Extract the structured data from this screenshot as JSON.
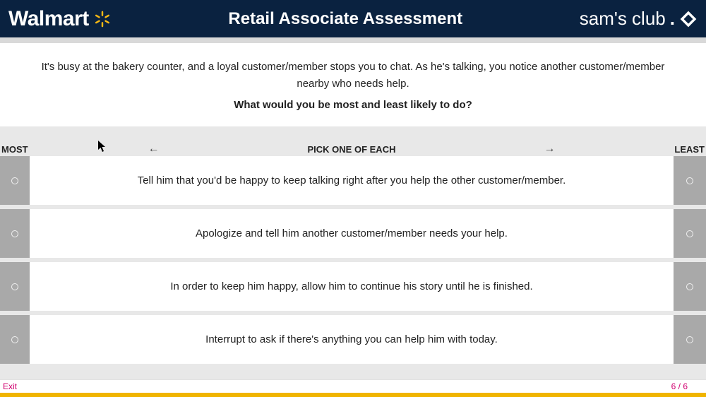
{
  "header": {
    "left_brand": "Walmart",
    "title": "Retail Associate Assessment",
    "right_brand": "sam's club"
  },
  "scenario": {
    "text": "It's busy at the bakery counter, and a loyal customer/member stops you to chat. As he's talking, you notice another customer/member nearby who needs help.",
    "question": "What would you be most and least likely to do?"
  },
  "columns": {
    "most": "MOST",
    "center": "PICK ONE OF EACH",
    "least": "LEAST"
  },
  "options": [
    "Tell him that you'd be happy to keep talking right after you help the other customer/member.",
    "Apologize and tell him another customer/member needs your help.",
    "In order to keep him happy, allow him to continue his story until he is finished.",
    "Interrupt to ask if there's anything you can help him with today."
  ],
  "footer": {
    "exit": "Exit",
    "page": "6 / 6"
  }
}
